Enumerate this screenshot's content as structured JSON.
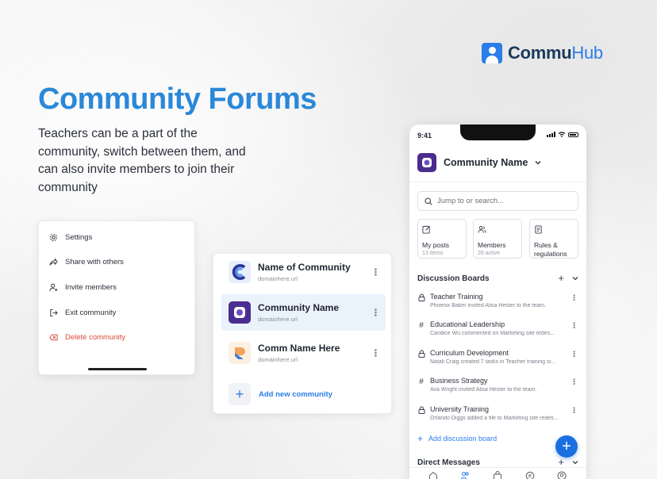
{
  "brand": {
    "name_part1": "Commu",
    "name_part2": "Hub",
    "color": "#2b7de9"
  },
  "hero": {
    "title": "Community Forums",
    "description": "Teachers can be a part of the community, switch between them, and can also invite members to join their community"
  },
  "menu": {
    "items": [
      {
        "label": "Settings",
        "icon": "gear-icon"
      },
      {
        "label": "Share with others",
        "icon": "share-icon"
      },
      {
        "label": "Invite members",
        "icon": "add-user-icon"
      },
      {
        "label": "Exit community",
        "icon": "exit-icon"
      },
      {
        "label": "Delete community",
        "icon": "delete-icon",
        "danger": true
      }
    ]
  },
  "community_list": {
    "items": [
      {
        "name": "Name of Community",
        "url": "domainhere.url",
        "active": false
      },
      {
        "name": "Community Name",
        "url": "domainhere.url",
        "active": true
      },
      {
        "name": "Comm Name Here",
        "url": "domainhere.url",
        "active": false
      }
    ],
    "add_label": "Add new community"
  },
  "phone": {
    "time": "9:41",
    "community_name": "Community Name",
    "search_placeholder": "Jump to or search...",
    "quick_links": [
      {
        "label": "My posts",
        "sub": "13 items",
        "icon": "edit-icon"
      },
      {
        "label": "Members",
        "sub": "26 active",
        "icon": "members-icon"
      },
      {
        "label": "Rules & regulations",
        "sub": "",
        "icon": "document-icon"
      }
    ],
    "discussion_title": "Discussion Boards",
    "boards": [
      {
        "name": "Teacher Training",
        "sub": "Phoenix Baker invited Alisa Hester to the team.",
        "icon": "lock"
      },
      {
        "name": "Educational Leadership",
        "sub": "Candice Wu commented on Marketing site redes...",
        "icon": "hash"
      },
      {
        "name": "Curriculum Development",
        "sub": "Natali Craig created 7 tasks in Teacher training si...",
        "icon": "lock"
      },
      {
        "name": "Business Strategy",
        "sub": "Ava Wright invited Alisa Hester to the team.",
        "icon": "hash"
      },
      {
        "name": "University Training",
        "sub": "Orlando Diggs added a file to Marketing site redes...",
        "icon": "lock"
      }
    ],
    "add_board_label": "Add discussion board",
    "dm_title": "Direct Messages"
  }
}
